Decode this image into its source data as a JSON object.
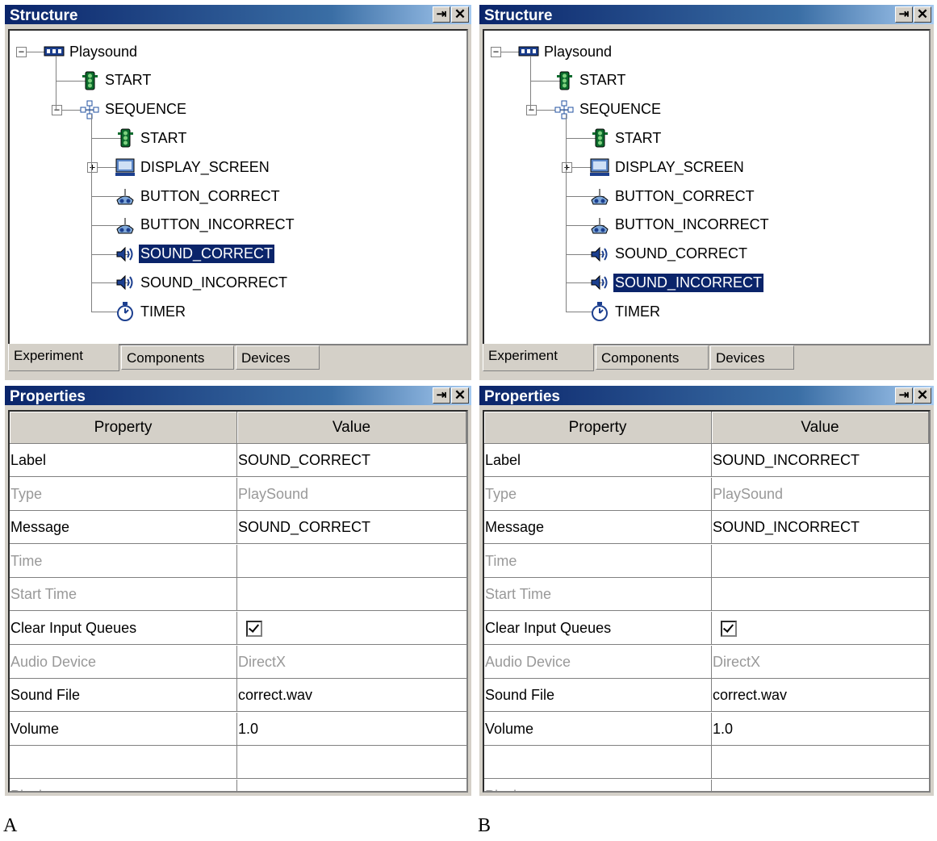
{
  "structure_title": "Structure",
  "properties_title": "Properties",
  "pin_glyph": "⇥",
  "close_glyph": "✕",
  "tabs": [
    "Experiment",
    "Components",
    "Devices"
  ],
  "grid_headers": [
    "Property",
    "Value"
  ],
  "tree_icons": {
    "root": "network-node-icon",
    "start": "traffic-light-icon",
    "sequence": "sequence-icon",
    "display": "monitor-icon",
    "button": "gamepad-icon",
    "sound": "speaker-icon",
    "timer": "stopwatch-icon"
  },
  "colors": {
    "titlebar": "#0a246a",
    "selection": "#0a246a",
    "face": "#d4d0c8"
  },
  "panels": [
    {
      "caption": "A",
      "tree": [
        {
          "label": "Playsound",
          "icon": "root"
        },
        {
          "label": "START",
          "icon": "start"
        },
        {
          "label": "SEQUENCE",
          "icon": "sequence"
        },
        {
          "label": "START",
          "icon": "start"
        },
        {
          "label": "DISPLAY_SCREEN",
          "icon": "display"
        },
        {
          "label": "BUTTON_CORRECT",
          "icon": "button"
        },
        {
          "label": "BUTTON_INCORRECT",
          "icon": "button"
        },
        {
          "label": "SOUND_CORRECT",
          "icon": "sound",
          "selected": true
        },
        {
          "label": "SOUND_INCORRECT",
          "icon": "sound"
        },
        {
          "label": "TIMER",
          "icon": "timer"
        }
      ],
      "rows": [
        {
          "property": "Label",
          "value": "SOUND_CORRECT"
        },
        {
          "property": "Type",
          "value": "PlaySound",
          "dim": true
        },
        {
          "property": "Message",
          "value": "SOUND_CORRECT"
        },
        {
          "property": "Time",
          "value": "",
          "dim": true
        },
        {
          "property": "Start Time",
          "value": "",
          "dim": true
        },
        {
          "property": "Clear Input Queues",
          "value": "",
          "checkbox": true
        },
        {
          "property": "Audio Device",
          "value": "DirectX",
          "dim": true
        },
        {
          "property": "Sound File",
          "value": "correct.wav"
        },
        {
          "property": "Volume",
          "value": "1.0"
        },
        {
          "property": "",
          "value": ""
        },
        {
          "property": "Playing",
          "value": "",
          "dim": true
        }
      ]
    },
    {
      "caption": "B",
      "tree": [
        {
          "label": "Playsound",
          "icon": "root"
        },
        {
          "label": "START",
          "icon": "start"
        },
        {
          "label": "SEQUENCE",
          "icon": "sequence"
        },
        {
          "label": "START",
          "icon": "start"
        },
        {
          "label": "DISPLAY_SCREEN",
          "icon": "display"
        },
        {
          "label": "BUTTON_CORRECT",
          "icon": "button"
        },
        {
          "label": "BUTTON_INCORRECT",
          "icon": "button"
        },
        {
          "label": "SOUND_CORRECT",
          "icon": "sound"
        },
        {
          "label": "SOUND_INCORRECT",
          "icon": "sound",
          "selected": true
        },
        {
          "label": "TIMER",
          "icon": "timer"
        }
      ],
      "rows": [
        {
          "property": "Label",
          "value": "SOUND_INCORRECT"
        },
        {
          "property": "Type",
          "value": "PlaySound",
          "dim": true
        },
        {
          "property": "Message",
          "value": "SOUND_INCORRECT"
        },
        {
          "property": "Time",
          "value": "",
          "dim": true
        },
        {
          "property": "Start Time",
          "value": "",
          "dim": true
        },
        {
          "property": "Clear Input Queues",
          "value": "",
          "checkbox": true
        },
        {
          "property": "Audio Device",
          "value": "DirectX",
          "dim": true
        },
        {
          "property": "Sound File",
          "value": "correct.wav"
        },
        {
          "property": "Volume",
          "value": "1.0"
        },
        {
          "property": "",
          "value": ""
        },
        {
          "property": "Playing",
          "value": "",
          "dim": true
        }
      ]
    }
  ]
}
